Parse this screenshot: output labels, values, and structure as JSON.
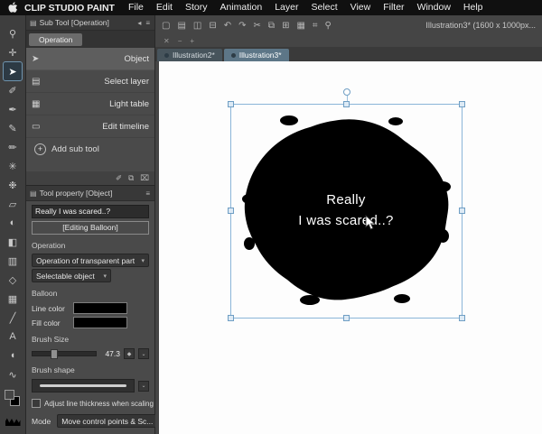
{
  "colors": {
    "accent_selection_blue": "#8ab5d8",
    "menubar_bg": "#101010",
    "panel_bg": "#4a4a4a",
    "canvas_white": "#fdfdfd",
    "balloon_fill": "#000000",
    "line_color_swatch": "#000000",
    "fill_color_swatch": "#000000"
  },
  "icons": {
    "chevron_down": "▾",
    "chevron_small": "⌄",
    "panel_menu": "≡",
    "panel_tab_icon": "▤",
    "collapse_left": "◂",
    "close": "✕",
    "minimize": "−",
    "zoom_btn": "+",
    "plus": "+",
    "stepper_diamond": "◆"
  },
  "menubar": {
    "app_name": "CLIP STUDIO PAINT",
    "items": [
      "File",
      "Edit",
      "Story",
      "Animation",
      "Layer",
      "Select",
      "View",
      "Filter",
      "Window",
      "Help"
    ]
  },
  "toolstrip": {
    "tools": [
      {
        "name": "zoom",
        "glyph": "⚲"
      },
      {
        "name": "move",
        "glyph": "✛"
      },
      {
        "name": "operation",
        "glyph": "➤",
        "selected": true
      },
      {
        "name": "eyedropper",
        "glyph": "✐"
      },
      {
        "name": "pen",
        "glyph": "✒"
      },
      {
        "name": "pencil",
        "glyph": "✎"
      },
      {
        "name": "brush",
        "glyph": "✏"
      },
      {
        "name": "airbrush",
        "glyph": "✳"
      },
      {
        "name": "decoration",
        "glyph": "❉"
      },
      {
        "name": "eraser",
        "glyph": "▱"
      },
      {
        "name": "blend",
        "glyph": "◐"
      },
      {
        "name": "fill",
        "glyph": "◧"
      },
      {
        "name": "gradient",
        "glyph": "▥"
      },
      {
        "name": "figure",
        "glyph": "◇"
      },
      {
        "name": "frame",
        "glyph": "▦"
      },
      {
        "name": "ruler",
        "glyph": "╱"
      },
      {
        "name": "text",
        "glyph": "A"
      },
      {
        "name": "balloon",
        "glyph": "◖"
      },
      {
        "name": "correction",
        "glyph": "∿"
      }
    ]
  },
  "subtool_panel": {
    "title": "Sub Tool [Operation]",
    "group_tab": "Operation",
    "items": [
      {
        "label": "Object",
        "glyph": "➤",
        "selected": true
      },
      {
        "label": "Select layer",
        "glyph": "▤",
        "selected": false
      },
      {
        "label": "Light table",
        "glyph": "▦",
        "selected": false
      },
      {
        "label": "Edit timeline",
        "glyph": "▭",
        "selected": false
      }
    ],
    "add_label": "Add sub tool",
    "footer_icons": [
      {
        "name": "eyedropper",
        "glyph": "✐"
      },
      {
        "name": "duplicate",
        "glyph": "⧉"
      },
      {
        "name": "delete",
        "glyph": "⌧"
      }
    ]
  },
  "tool_property": {
    "title": "Tool property [Object]",
    "text_preview": "Really I was scared..?",
    "editing_label": "[Editing Balloon]",
    "operation_section": "Operation",
    "dropdown_transparent": "Operation of transparent part",
    "dropdown_selectable": "Selectable object",
    "balloon_section": "Balloon",
    "line_color_label": "Line color",
    "fill_color_label": "Fill color",
    "brush_size_label": "Brush Size",
    "brush_size_value": "47.3",
    "brush_shape_label": "Brush shape",
    "adjust_checkbox_label": "Adjust line thickness when scaling",
    "mode_label": "Mode",
    "mode_value": "Move control points & Sc..."
  },
  "window": {
    "title": "Illustration3* (1600 x 1000px...",
    "toolbar_icons": [
      {
        "name": "new-file",
        "glyph": "▢"
      },
      {
        "name": "open",
        "glyph": "▤"
      },
      {
        "name": "save",
        "glyph": "◫"
      },
      {
        "name": "print",
        "glyph": "⊟"
      },
      {
        "name": "undo",
        "glyph": "↶"
      },
      {
        "name": "redo",
        "glyph": "↷"
      },
      {
        "name": "cut",
        "glyph": "✂"
      },
      {
        "name": "copy",
        "glyph": "⧉"
      },
      {
        "name": "paste",
        "glyph": "⊞"
      },
      {
        "name": "grid",
        "glyph": "▦"
      },
      {
        "name": "snap",
        "glyph": "⌗"
      },
      {
        "name": "zoom",
        "glyph": "⚲"
      }
    ]
  },
  "document": {
    "tabs": [
      {
        "label": "Illustration2*",
        "active": false
      },
      {
        "label": "Illustration3*",
        "active": true
      }
    ],
    "balloon": {
      "line1": "Really",
      "line2": "I was scared..?"
    }
  }
}
